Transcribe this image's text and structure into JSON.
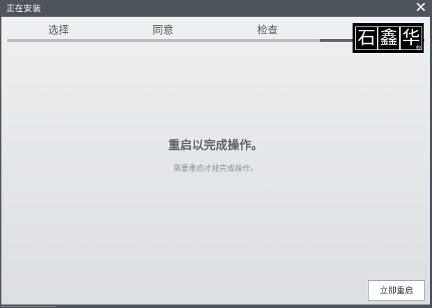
{
  "window": {
    "title": "正在安装"
  },
  "steps": [
    {
      "label": "选择"
    },
    {
      "label": "同意"
    },
    {
      "label": "检查"
    }
  ],
  "progress": {
    "active_step_index": 3,
    "total_steps": 4
  },
  "logo": {
    "chars": [
      "石",
      "鑫",
      "华"
    ],
    "registered_mark": "®"
  },
  "main": {
    "message": "重启以完成操作。",
    "sub_message": "需要重启才能完成操作。"
  },
  "buttons": {
    "restart_label": "立即重启"
  },
  "colors": {
    "titlebar": "#4e545b",
    "progress_active": "#60666d",
    "progress_inactive": "#b9bdc1"
  },
  "icons": {
    "close": "close-icon"
  }
}
